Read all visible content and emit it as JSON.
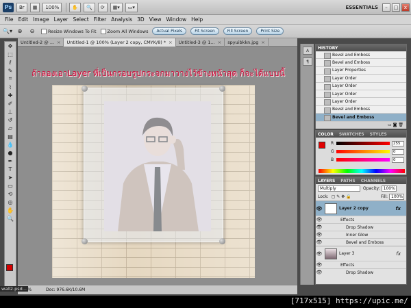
{
  "topbar": {
    "ps_logo": "Ps",
    "br_label": "Br",
    "zoom_value": "100%",
    "workspace": "ESSENTIALS",
    "min": "–",
    "max": "□",
    "close": "x"
  },
  "menu": [
    "File",
    "Edit",
    "Image",
    "Layer",
    "Select",
    "Filter",
    "Analysis",
    "3D",
    "View",
    "Window",
    "Help"
  ],
  "options": {
    "resize_windows": "Resize Windows To Fit",
    "zoom_all": "Zoom All Windows",
    "actual_pixels": "Actual Pixels",
    "fit_screen": "Fit Screen",
    "fill_screen": "Fill Screen",
    "print_size": "Print Size"
  },
  "tabs": [
    {
      "label": "Untitled-2 @ ..."
    },
    {
      "label": "Untitled-1 @ 100% (Layer 2 copy, CMYK/8) *"
    },
    {
      "label": "Untitled-3 @ 1..."
    },
    {
      "label": "spyuibkkn.jpg"
    }
  ],
  "canvas": {
    "overlay_text": "ถ้าลองเอาLayer ที่เป็นกรอบรูปกระจกมาวางไว้ข้างหน้าสุด ก็จะได้แบบนี้"
  },
  "status": {
    "zoom": "100%",
    "doc": "Doc: 976.6K/10.6M"
  },
  "history": {
    "title": "HISTORY",
    "items": [
      {
        "label": "Bevel and Emboss",
        "selected": false
      },
      {
        "label": "Bevel and Emboss",
        "selected": false
      },
      {
        "label": "Layer Properties",
        "selected": false
      },
      {
        "label": "Layer Order",
        "selected": false
      },
      {
        "label": "Layer Order",
        "selected": false
      },
      {
        "label": "Layer Order",
        "selected": false
      },
      {
        "label": "Layer Order",
        "selected": false
      },
      {
        "label": "Bevel and Emboss",
        "selected": false
      },
      {
        "label": "Bevel and Emboss",
        "selected": true
      }
    ]
  },
  "color_panel": {
    "tabs": [
      "COLOR",
      "SWATCHES",
      "STYLES"
    ],
    "channels": [
      {
        "label": "R",
        "value": "255"
      },
      {
        "label": "G",
        "value": "0"
      },
      {
        "label": "B",
        "value": "0"
      }
    ],
    "foreground": "#e00000",
    "background": "#000000"
  },
  "layers": {
    "tabs": [
      "LAYERS",
      "PATHS",
      "CHANNELS"
    ],
    "blend_mode": "Multiply",
    "opacity_label": "Opacity:",
    "opacity": "100%",
    "lock_label": "Lock:",
    "fill_label": "Fill:",
    "fill": "100%",
    "fx": "fx",
    "rows": [
      {
        "kind": "layer",
        "label": "Layer 2 copy",
        "selected": true,
        "thumb": "glass"
      },
      {
        "kind": "effects",
        "label": "Effects"
      },
      {
        "kind": "effect",
        "label": "Drop Shadow"
      },
      {
        "kind": "effect",
        "label": "Inner Glow"
      },
      {
        "kind": "effect",
        "label": "Bevel and Emboss"
      },
      {
        "kind": "layer",
        "label": "Layer 3",
        "selected": false,
        "thumb": "photo"
      },
      {
        "kind": "effects",
        "label": "Effects"
      },
      {
        "kind": "effect",
        "label": "Drop Shadow"
      }
    ]
  },
  "footer": {
    "file_tab": "wall2.psd...",
    "watermark": "[717x515] https://upic.me/"
  }
}
